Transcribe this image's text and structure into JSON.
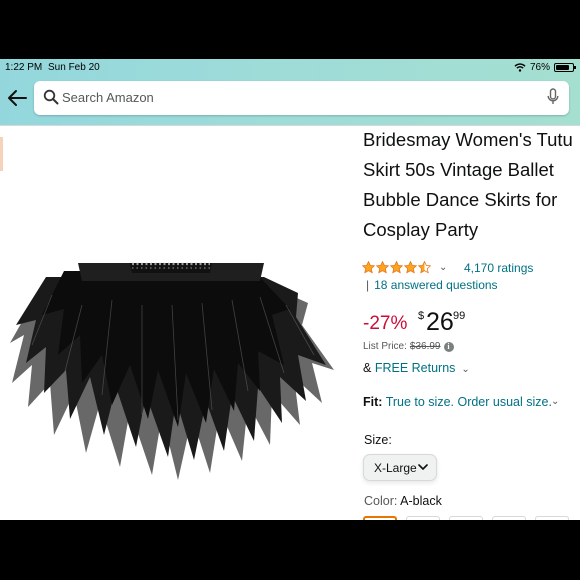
{
  "status_bar": {
    "time": "1:22 PM",
    "date": "Sun Feb 20",
    "battery": "76%"
  },
  "search": {
    "placeholder": "Search Amazon"
  },
  "product": {
    "title": "Bridesmay Women's Tutu Skirt 50s Vintage Ballet Bubble Dance Skirts for Cosplay Party",
    "rating_stars": 4.5,
    "ratings_count": "4,170 ratings",
    "answered_questions": "18 answered questions",
    "discount": "-27%",
    "price_symbol": "$",
    "price_whole": "26",
    "price_fraction": "99",
    "list_price_label": "List Price:",
    "list_price": "$36.99",
    "returns_prefix": "&",
    "returns_link": "FREE Returns",
    "fit_label": "Fit:",
    "fit_value": "True to size. Order usual size.",
    "size_label": "Size:",
    "size_selected": "X-Large",
    "color_label": "Color:",
    "color_selected": "A-black",
    "color_swatch_count": 5
  },
  "colors": {
    "header_gradient_start": "#93d7dd",
    "header_gradient_end": "#a4dfd0",
    "link": "#007185",
    "discount": "#cc0c39",
    "star": "#ffa41c",
    "selected_swatch_border": "#e77600"
  },
  "icons": [
    "back-arrow-icon",
    "search-icon",
    "mic-icon",
    "wifi-icon",
    "battery-icon",
    "star-icon",
    "chevron-down-icon",
    "info-icon"
  ]
}
